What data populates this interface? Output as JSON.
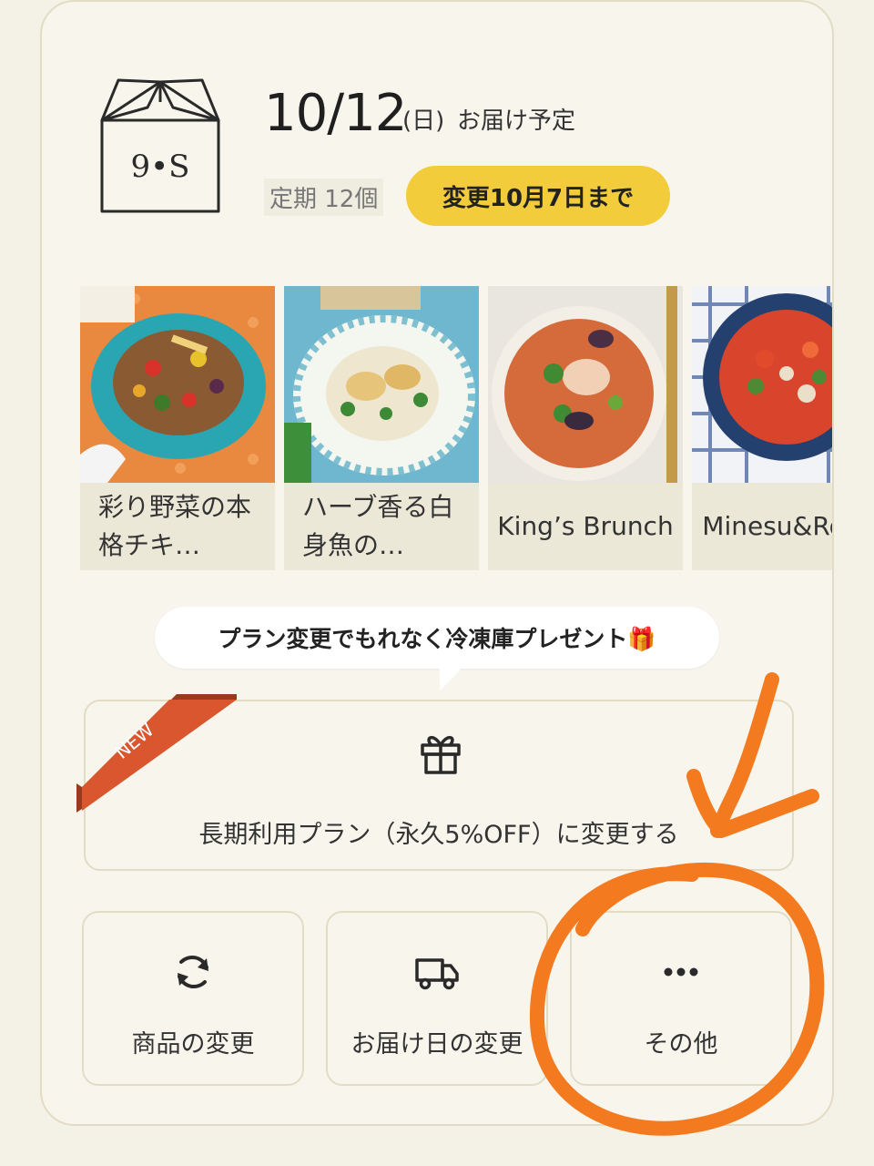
{
  "delivery": {
    "date": "10/12",
    "day_of_week": "(日)",
    "status": "お届け予定",
    "plan": "定期 12個",
    "deadline_label": "変更10月7日まで"
  },
  "box_logo_text": "9•S",
  "products": [
    {
      "name": "彩り野菜の本格チキ…"
    },
    {
      "name": "ハーブ香る白身魚の…"
    },
    {
      "name": "King’s Brunch"
    },
    {
      "name": "Minesu&Rone"
    }
  ],
  "promo": {
    "bubble_text": "プラン変更でもれなく冷凍庫プレゼント🎁",
    "ribbon_label": "NEW",
    "long_plan_label": "長期利用プラン（永久5%OFF）に変更する"
  },
  "actions": [
    {
      "label": "商品の変更",
      "icon": "refresh-icon"
    },
    {
      "label": "お届け日の変更",
      "icon": "truck-icon"
    },
    {
      "label": "その他",
      "icon": "more-dots-icon"
    }
  ],
  "colors": {
    "accent_yellow": "#f2cc3a",
    "ribbon_red": "#d9562f",
    "annotation_orange": "#f47a20",
    "card_bg": "#f7f5ec",
    "border": "#e2dcc5"
  }
}
